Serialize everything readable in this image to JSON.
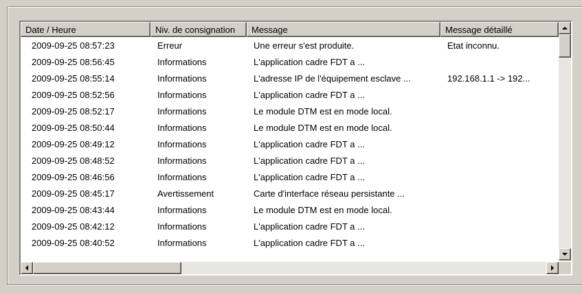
{
  "columns": [
    "Date / Heure",
    "Niv. de consignation",
    "Message",
    "Message détaillé"
  ],
  "rows": [
    [
      "2009-09-25 08:57:23",
      "Erreur",
      "Une erreur s'est produite.",
      "Etat inconnu."
    ],
    [
      "2009-09-25 08:56:45",
      "Informations",
      "L'application cadre FDT a ...",
      ""
    ],
    [
      "2009-09-25 08:55:14",
      "Informations",
      "L'adresse IP de l'équipement esclave ...",
      "192.168.1.1 -> 192..."
    ],
    [
      "2009-09-25 08:52:56",
      "Informations",
      "L'application cadre FDT a ...",
      ""
    ],
    [
      "2009-09-25 08:52:17",
      "Informations",
      "Le module DTM est en mode local.",
      ""
    ],
    [
      "2009-09-25 08:50:44",
      "Informations",
      "Le module DTM est en mode local.",
      ""
    ],
    [
      "2009-09-25 08:49:12",
      "Informations",
      "L'application cadre FDT a ...",
      ""
    ],
    [
      "2009-09-25 08:48:52",
      "Informations",
      "L'application cadre FDT a ...",
      ""
    ],
    [
      "2009-09-25 08:46:56",
      "Informations",
      "L'application cadre FDT a ...",
      ""
    ],
    [
      "2009-09-25 08:45:17",
      "Avertissement",
      "Carte d'interface réseau persistante ...",
      ""
    ],
    [
      "2009-09-25 08:43:44",
      "Informations",
      "Le module DTM est en mode local.",
      ""
    ],
    [
      "2009-09-25 08:42:12",
      "Informations",
      "L'application cadre FDT a ...",
      ""
    ],
    [
      "2009-09-25 08:40:52",
      "Informations",
      "L'application cadre FDT a ...",
      ""
    ]
  ],
  "icons": {
    "scroll_up": "arrow-up-icon",
    "scroll_down": "arrow-down-icon",
    "scroll_left": "arrow-left-icon",
    "scroll_right": "arrow-right-icon"
  },
  "scroll": {
    "vertical_position": 0.0,
    "horizontal_position": 0.0
  }
}
